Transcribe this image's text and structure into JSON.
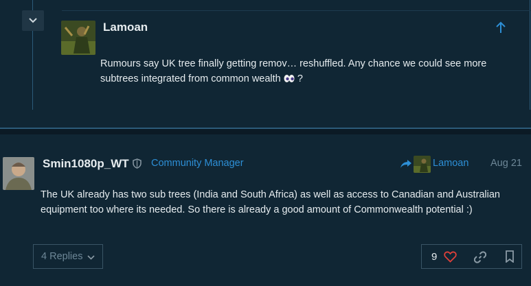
{
  "quote": {
    "username": "Lamoan",
    "text": "Rumours say UK tree finally getting remov… reshuffled. Any chance we could see more subtrees integrated from common wealth",
    "text_suffix": "?",
    "emoji": "eyes-emoji"
  },
  "post": {
    "username": "Smin1080p_WT",
    "role": "Community Manager",
    "reply_to": "Lamoan",
    "date": "Aug 21",
    "text": "The UK already has two sub trees (India and South Africa) as well as access to Canadian and Australian equipment too where its needed. So there is already a good amount of Commonwealth potential :)"
  },
  "controls": {
    "replies_label": "4 Replies",
    "like_count": "9"
  },
  "icons": {
    "collapse": "chevron-down-icon",
    "scroll_up": "arrow-up-icon",
    "moderator": "shield-icon",
    "reply": "reply-arrow-icon",
    "like": "heart-icon",
    "link": "link-icon",
    "bookmark": "bookmark-icon"
  },
  "colors": {
    "background": "#102634",
    "accent": "#2d8fd6",
    "muted": "#6d8797",
    "heart": "#e0403a"
  }
}
